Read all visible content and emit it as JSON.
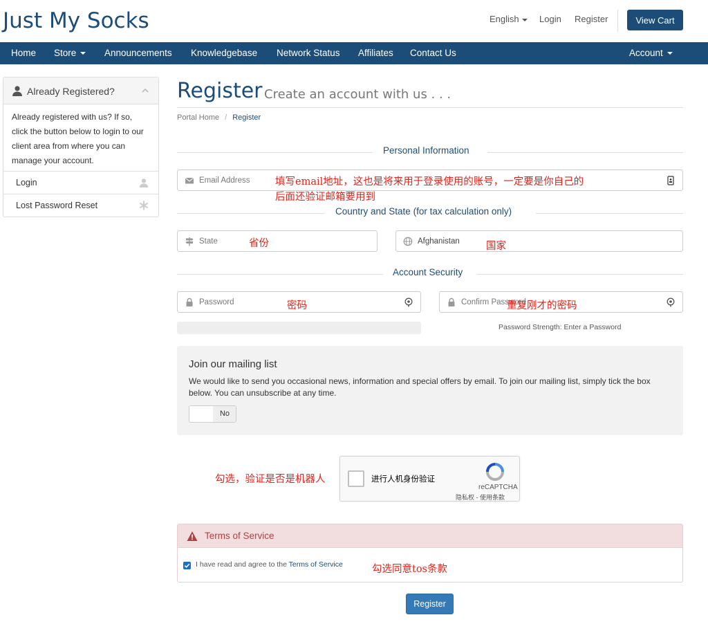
{
  "brand": "Just My Socks",
  "topbar": {
    "language": "English",
    "login": "Login",
    "register": "Register",
    "view_cart": "View Cart"
  },
  "nav": {
    "home": "Home",
    "store": "Store",
    "announcements": "Announcements",
    "knowledgebase": "Knowledgebase",
    "network_status": "Network Status",
    "affiliates": "Affiliates",
    "contact_us": "Contact Us",
    "account": "Account"
  },
  "sidebar": {
    "title": "Already Registered?",
    "body": "Already registered with us? If so, click the button below to login to our client area from where you can manage your account.",
    "items": [
      "Login",
      "Lost Password Reset"
    ]
  },
  "page": {
    "title": "Register",
    "subtitle": "Create an account with us . . .",
    "breadcrumb": [
      "Portal Home",
      "Register"
    ]
  },
  "sections": {
    "personal": "Personal Information",
    "country": "Country and State (for tax calculation only)",
    "security": "Account Security"
  },
  "fields": {
    "email_placeholder": "Email Address",
    "state_placeholder": "State",
    "country_value": "Afghanistan",
    "password_placeholder": "Password",
    "confirm_placeholder": "Confirm Password"
  },
  "password_strength": "Password Strength: Enter a Password",
  "mailing": {
    "title": "Join our mailing list",
    "description": "We would like to send you occasional news, information and special offers by email. To join our mailing list, simply tick the box below. You can unsubscribe at any time.",
    "toggle_value": "No"
  },
  "captcha": {
    "label": "进行人机身份验证",
    "brand": "reCAPTCHA",
    "privacy": "隐私权 - 使用条款"
  },
  "tos": {
    "title": "Terms of Service",
    "agree_prefix": "I have read and agree to the",
    "agree_link": "Terms of Service",
    "checked": true
  },
  "submit": "Register",
  "annotations": {
    "email_line1": "填写email地址，这也是将来用于登录使用的账号，一定要是你自己的",
    "email_line2": "后面还验证邮箱要用到",
    "state": "省份",
    "country": "国家",
    "password": "密码",
    "confirm": "重复刚才的密码",
    "captcha": "勾选，验证是否是机器人",
    "tos": "勾选同意tos条款"
  },
  "colors": {
    "brand": "#1c4d78",
    "annotation": "#e0241b",
    "button": "#337ab7"
  }
}
